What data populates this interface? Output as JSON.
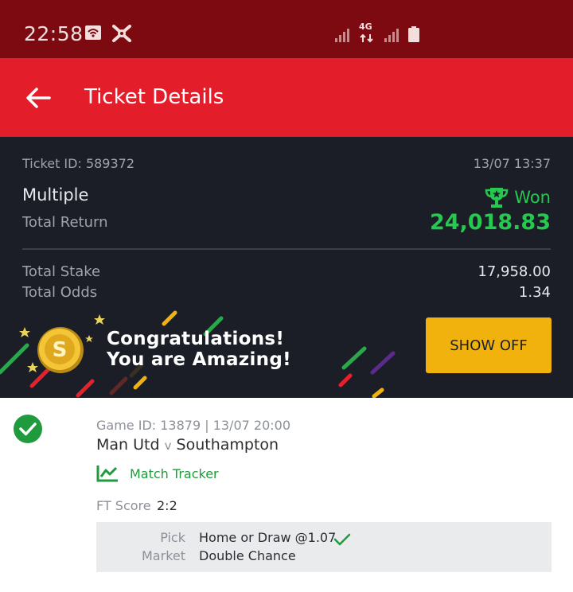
{
  "status_bar": {
    "time": "22:58",
    "network_label": "4G"
  },
  "header": {
    "title": "Ticket Details"
  },
  "ticket": {
    "id_label": "Ticket ID: 589372",
    "datetime": "13/07 13:37",
    "bet_type": "Multiple",
    "status": "Won",
    "total_return_label": "Total Return",
    "total_return_value": "24,018.83",
    "total_stake_label": "Total Stake",
    "total_stake_value": "17,958.00",
    "total_odds_label": "Total Odds",
    "total_odds_value": "1.34"
  },
  "banner": {
    "line1": "Congratulations!",
    "line2": "You are Amazing!",
    "show_off_label": "SHOW OFF"
  },
  "selection": {
    "game_meta": "Game ID: 13879 | 13/07 20:00",
    "home_team": "Man Utd",
    "versus": "v",
    "away_team": "Southampton",
    "match_tracker_label": "Match Tracker",
    "ft_score_label": "FT Score",
    "ft_score_value": "2:2",
    "pick_label": "Pick",
    "pick_value": "Home or Draw @1.07",
    "market_label": "Market",
    "market_value": "Double Chance"
  },
  "colors": {
    "status_bar": "#7c0a10",
    "app_bar": "#e41d2b",
    "panel": "#1b1e27",
    "won_green": "#26c94f",
    "button_yellow": "#f2b20e"
  }
}
